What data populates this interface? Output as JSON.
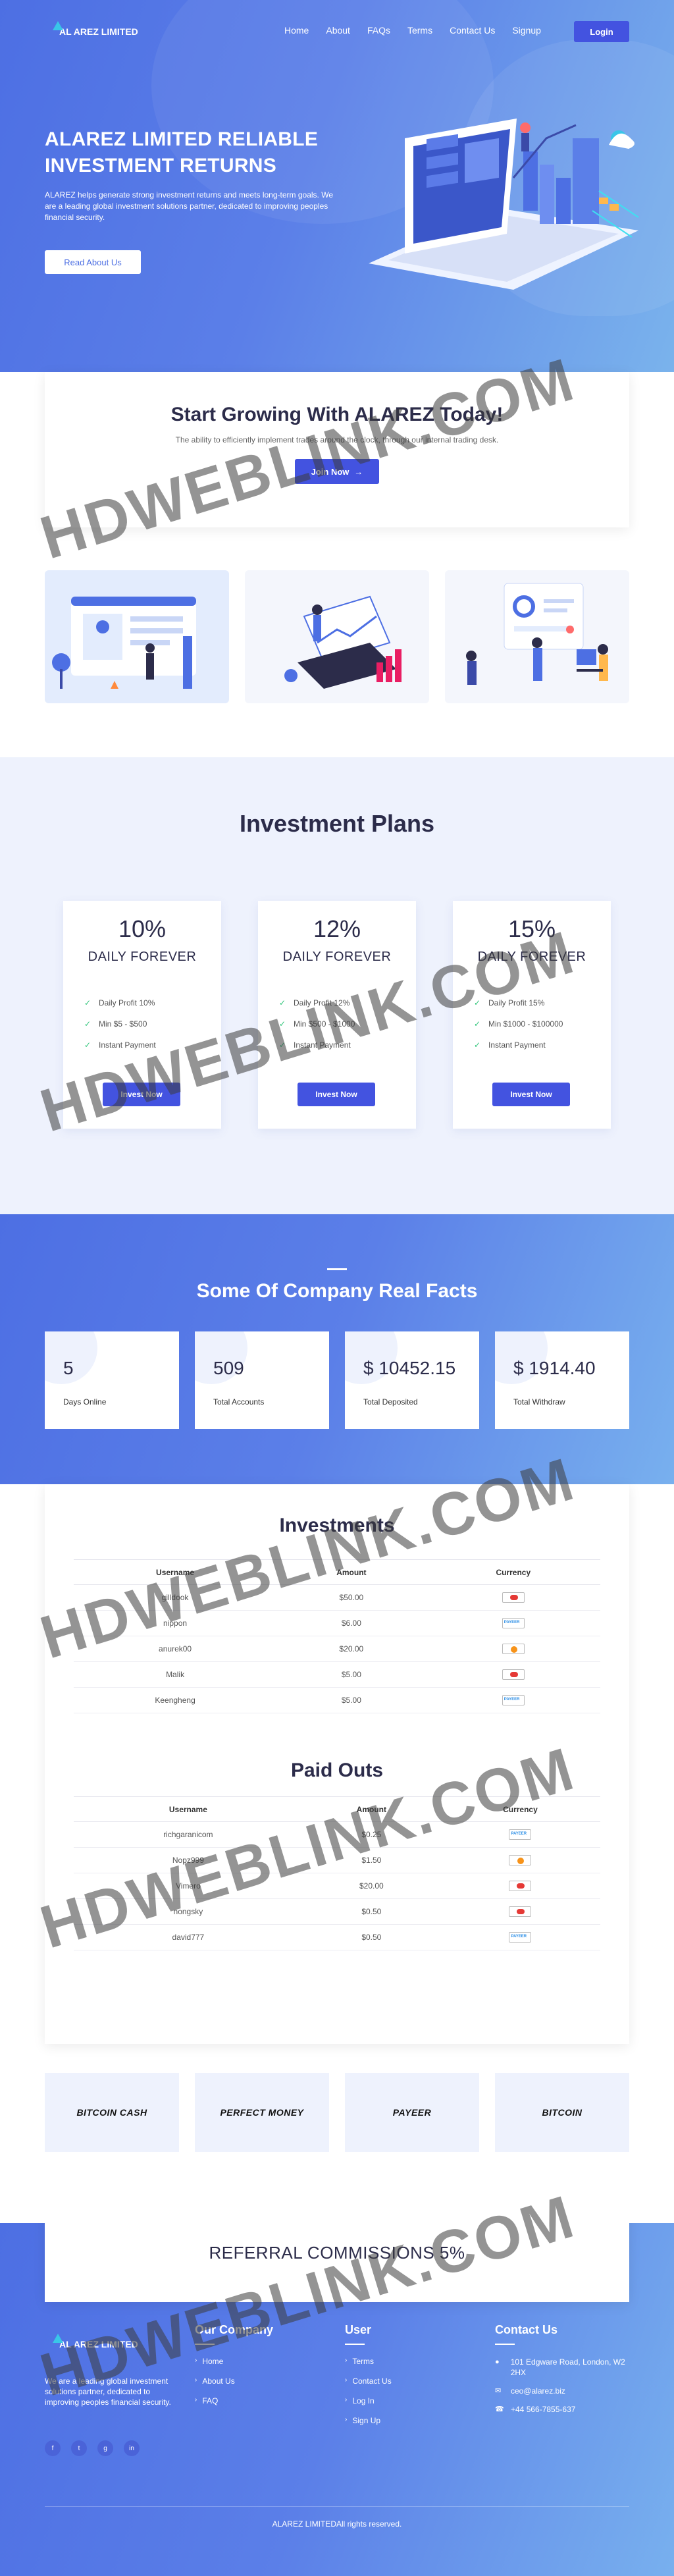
{
  "brand": {
    "name": "AL AREZ LIMITED"
  },
  "nav": {
    "links": [
      "Home",
      "About",
      "FAQs",
      "Terms",
      "Contact Us",
      "Signup"
    ],
    "login": "Login"
  },
  "hero": {
    "title": "ALAREZ LIMITED RELIABLE INVESTMENT RETURNS",
    "description": "ALAREZ helps generate strong investment returns and meets long-term goals. We are a leading global investment solutions partner, dedicated to improving peoples financial security.",
    "button": "Read About Us"
  },
  "cta": {
    "title": "Start Growing With ALAREZ Today!",
    "subtitle": "The ability to efficiently implement trades around the clock, through our internal trading desk.",
    "button": "Join Now"
  },
  "plans": {
    "title": "Investment Plans",
    "items": [
      {
        "percent": "10%",
        "period": "DAILY FOREVER",
        "features": [
          "Daily Profit 10%",
          "Min $5 - $500",
          "Instant Payment"
        ],
        "button": "Invest Now"
      },
      {
        "percent": "12%",
        "period": "DAILY FOREVER",
        "features": [
          "Daily Profit 12%",
          "Min $500 - $1000",
          "Instant Payment"
        ],
        "button": "Invest Now"
      },
      {
        "percent": "15%",
        "period": "DAILY FOREVER",
        "features": [
          "Daily Profit 15%",
          "Min $1000 - $100000",
          "Instant Payment"
        ],
        "button": "Invest Now"
      }
    ]
  },
  "facts": {
    "title": "Some Of Company Real Facts",
    "items": [
      {
        "value": "5",
        "label": "Days Online"
      },
      {
        "value": "509",
        "label": "Total Accounts"
      },
      {
        "value": "$ 10452.15",
        "label": "Total Deposited"
      },
      {
        "value": "$ 1914.40",
        "label": "Total Withdraw"
      }
    ]
  },
  "investments": {
    "title": "Investments",
    "columns": [
      "Username",
      "Amount",
      "Currency"
    ],
    "rows": [
      {
        "username": "gilldook",
        "amount": "$50.00",
        "currency": "perfect-money"
      },
      {
        "username": "nippon",
        "amount": "$6.00",
        "currency": "payeer"
      },
      {
        "username": "anurek00",
        "amount": "$20.00",
        "currency": "bitcoin"
      },
      {
        "username": "Malik",
        "amount": "$5.00",
        "currency": "perfect-money"
      },
      {
        "username": "Keengheng",
        "amount": "$5.00",
        "currency": "payeer"
      }
    ]
  },
  "payouts": {
    "title": "Paid Outs",
    "columns": [
      "Username",
      "Amount",
      "Currency"
    ],
    "rows": [
      {
        "username": "richgaranicom",
        "amount": "$0.25",
        "currency": "payeer"
      },
      {
        "username": "Nopz999",
        "amount": "$1.50",
        "currency": "bitcoin"
      },
      {
        "username": "Vimero",
        "amount": "$20.00",
        "currency": "perfect-money"
      },
      {
        "username": "nongsky",
        "amount": "$0.50",
        "currency": "perfect-money"
      },
      {
        "username": "david777",
        "amount": "$0.50",
        "currency": "payeer"
      }
    ]
  },
  "payments": [
    "BITCOIN CASH",
    "PERFECT MONEY",
    "PAYEER",
    "BITCOIN"
  ],
  "referral": {
    "title": "REFERRAL COMMISSIONS 5%"
  },
  "footer": {
    "about": "We are a leading global investment solutions partner, dedicated to improving peoples financial security.",
    "socials": [
      "f",
      "t",
      "g",
      "in"
    ],
    "company": {
      "title": "Our Company",
      "links": [
        "Home",
        "About Us",
        "FAQ"
      ]
    },
    "user": {
      "title": "User",
      "links": [
        "Terms",
        "Contact Us",
        "Log In",
        "Sign Up"
      ]
    },
    "contact": {
      "title": "Contact Us",
      "address": "101 Edgware Road, London, W2 2HX",
      "email": "ceo@alarez.biz",
      "phone": "+44 566-7855-637"
    },
    "copyright": "ALAREZ LIMITEDAll rights reserved."
  },
  "watermark": "HDWEBLINK.COM",
  "colors": {
    "accent": "#4353e0",
    "hero_start": "#4d6fe3",
    "hero_end": "#7ab3ec",
    "check": "#2fc57a"
  }
}
